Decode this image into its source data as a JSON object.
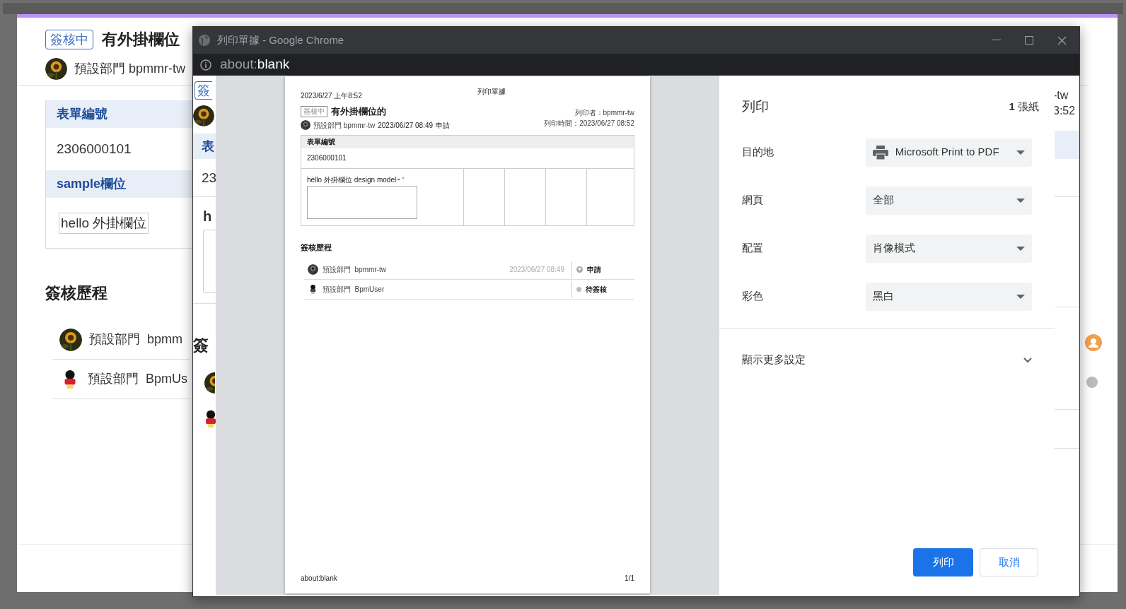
{
  "back_page": {
    "status_badge": "簽核中",
    "title": "有外掛欄位",
    "applicant": "預設部門 bpmmr-tw",
    "fields": [
      {
        "kind": "text",
        "label": "表單編號",
        "value": "2306000101"
      },
      {
        "kind": "input",
        "label": "sample欄位",
        "value": "hello 外掛欄位"
      }
    ],
    "history_title": "簽核歷程",
    "history": [
      {
        "dept": "預設部門",
        "user": "bpmm"
      },
      {
        "kind": "cartoon",
        "dept": "預設部門",
        "user": "BpmUs"
      }
    ]
  },
  "middle_page": {
    "badge": "簽",
    "field_label": "表",
    "field_value": "23",
    "plugin_label": "h",
    "history_title": "簽",
    "printer": "-tw",
    "print_time": "3:52"
  },
  "chrome": {
    "title": "列印單據 - Google Chrome",
    "url_scheme": "about:",
    "url_rest": "blank"
  },
  "preview": {
    "print_date": "2023/6/27 上午8:52",
    "header_title": "列印單據",
    "status_badge": "簽核中",
    "title": "有外掛欄位的",
    "applicant": "預設部門 bpmmr-tw",
    "applied_time": "2023/06/27 08:49",
    "action": "申請",
    "printer": "列印者：bpmmr-tw",
    "print_time": "列印時間：2023/06/27 08:52",
    "field_label": "表單編號",
    "field_value": "2306000101",
    "plugin_label": "hello 外掛欄位 design model~",
    "required_mark": "*",
    "history_title": "簽核歷程",
    "history": [
      {
        "kind": "done",
        "dept": "預設部門",
        "user": "bpmmr-tw",
        "time": "2023/06/27 08:49",
        "status": "申請"
      },
      {
        "kind": "pending",
        "dept": "預設部門",
        "user": "BpmUser",
        "status": "待簽核"
      }
    ],
    "footer_left": "about:blank",
    "footer_right": "1/1"
  },
  "print_settings": {
    "title": "列印",
    "sheets": "**1** 張紙",
    "settings": [
      {
        "kind": "printer",
        "label": "目的地",
        "value": "Microsoft Print to PDF"
      },
      {
        "kind": "plain",
        "label": "網頁",
        "value": "全部"
      },
      {
        "kind": "plain",
        "label": "配置",
        "value": "肖像模式"
      },
      {
        "kind": "plain",
        "label": "彩色",
        "value": "黑白"
      }
    ],
    "more_settings": "顯示更多設定",
    "print_button": "列印",
    "cancel_button": "取消"
  }
}
